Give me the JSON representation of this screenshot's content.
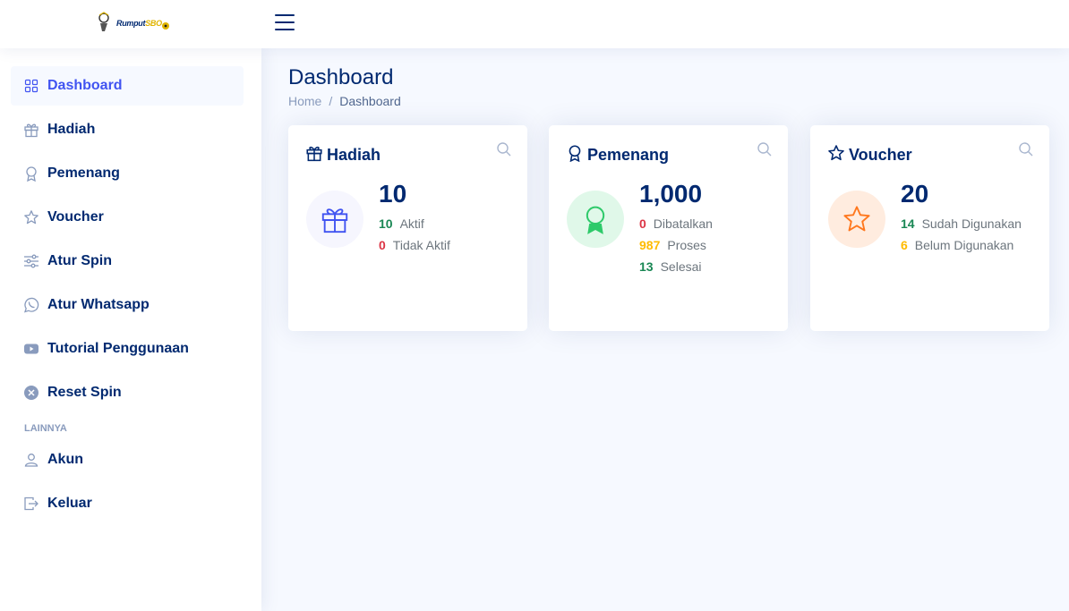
{
  "brand": {
    "logo_prefix": "Rumput",
    "logo_suffix": "SBO"
  },
  "sidebar": {
    "items": [
      {
        "label": "Dashboard",
        "icon": "grid-icon"
      },
      {
        "label": "Hadiah",
        "icon": "gift-icon"
      },
      {
        "label": "Pemenang",
        "icon": "award-icon"
      },
      {
        "label": "Voucher",
        "icon": "star-icon"
      },
      {
        "label": "Atur Spin",
        "icon": "sliders-icon"
      },
      {
        "label": "Atur Whatsapp",
        "icon": "whatsapp-icon"
      },
      {
        "label": "Tutorial Penggunaan",
        "icon": "youtube-icon"
      },
      {
        "label": "Reset Spin",
        "icon": "x-circle-icon"
      }
    ],
    "heading": "LAINNYA",
    "other_items": [
      {
        "label": "Akun",
        "icon": "person-icon"
      },
      {
        "label": "Keluar",
        "icon": "logout-icon"
      }
    ],
    "active": "Dashboard"
  },
  "page": {
    "title": "Dashboard",
    "breadcrumb": {
      "home": "Home",
      "separator": "/",
      "current": "Dashboard"
    }
  },
  "cards": {
    "hadiah": {
      "title": "Hadiah",
      "total": "10",
      "stats": [
        {
          "value": "10",
          "label": "Aktif",
          "color": "#198754"
        },
        {
          "value": "0",
          "label": "Tidak Aktif",
          "color": "#dc3545"
        }
      ]
    },
    "pemenang": {
      "title": "Pemenang",
      "total": "1,000",
      "stats": [
        {
          "value": "0",
          "label": "Dibatalkan",
          "color": "#dc3545"
        },
        {
          "value": "987",
          "label": "Proses",
          "color": "#ffbb00"
        },
        {
          "value": "13",
          "label": "Selesai",
          "color": "#198754"
        }
      ]
    },
    "voucher": {
      "title": "Voucher",
      "total": "20",
      "stats": [
        {
          "value": "14",
          "label": "Sudah Digunakan",
          "color": "#198754"
        },
        {
          "value": "6",
          "label": "Belum Digunakan",
          "color": "#ffbb00"
        }
      ]
    }
  },
  "colors": {
    "accent": "#4154f1",
    "navy": "#012970",
    "background": "#f6f9ff"
  }
}
